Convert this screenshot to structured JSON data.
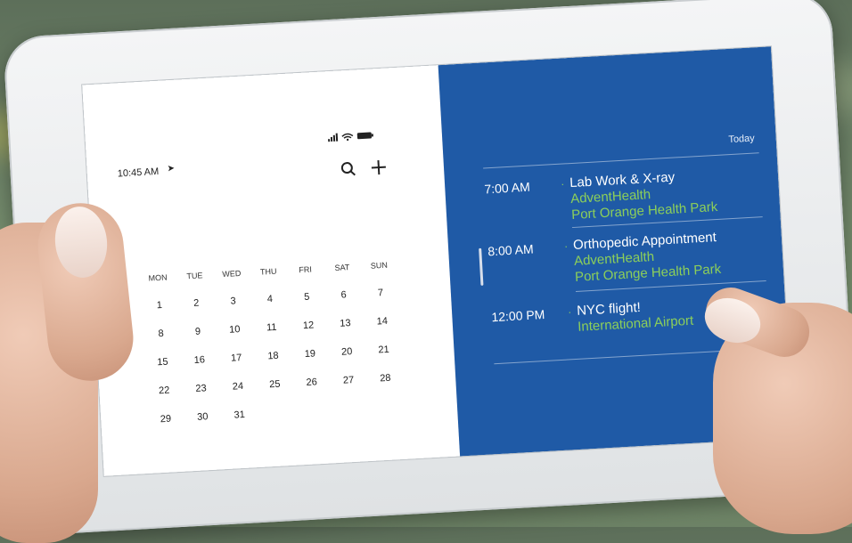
{
  "left_pane": {
    "status_time": "10:45 AM",
    "location_icon": "location-arrow-icon",
    "status_icons": "signal-wifi-battery-icons",
    "toolbar": {
      "search_icon": "search-icon",
      "add_icon": "plus-icon"
    },
    "weekdays": [
      "MON",
      "TUE",
      "WED",
      "THU",
      "FRI",
      "SAT",
      "SUN"
    ],
    "days": [
      "1",
      "2",
      "3",
      "4",
      "5",
      "6",
      "7",
      "8",
      "9",
      "10",
      "11",
      "12",
      "13",
      "14",
      "15",
      "16",
      "17",
      "18",
      "19",
      "20",
      "21",
      "22",
      "23",
      "24",
      "25",
      "26",
      "27",
      "28",
      "29",
      "30",
      "31"
    ]
  },
  "right_pane": {
    "today_label": "Today",
    "events": [
      {
        "time": "7:00 AM",
        "title": "Lab Work & X-ray",
        "lines": [
          "AdventHealth",
          "Port Orange Health Park"
        ]
      },
      {
        "time": "8:00 AM",
        "title": "Orthopedic Appointment",
        "lines": [
          "AdventHealth",
          "Port Orange Health Park"
        ]
      },
      {
        "time": "12:00 PM",
        "title": "NYC flight!",
        "lines": [
          "International Airport"
        ]
      }
    ]
  },
  "colors": {
    "accent_blue": "#1f5aa6",
    "accent_green": "#8ccf5a"
  }
}
